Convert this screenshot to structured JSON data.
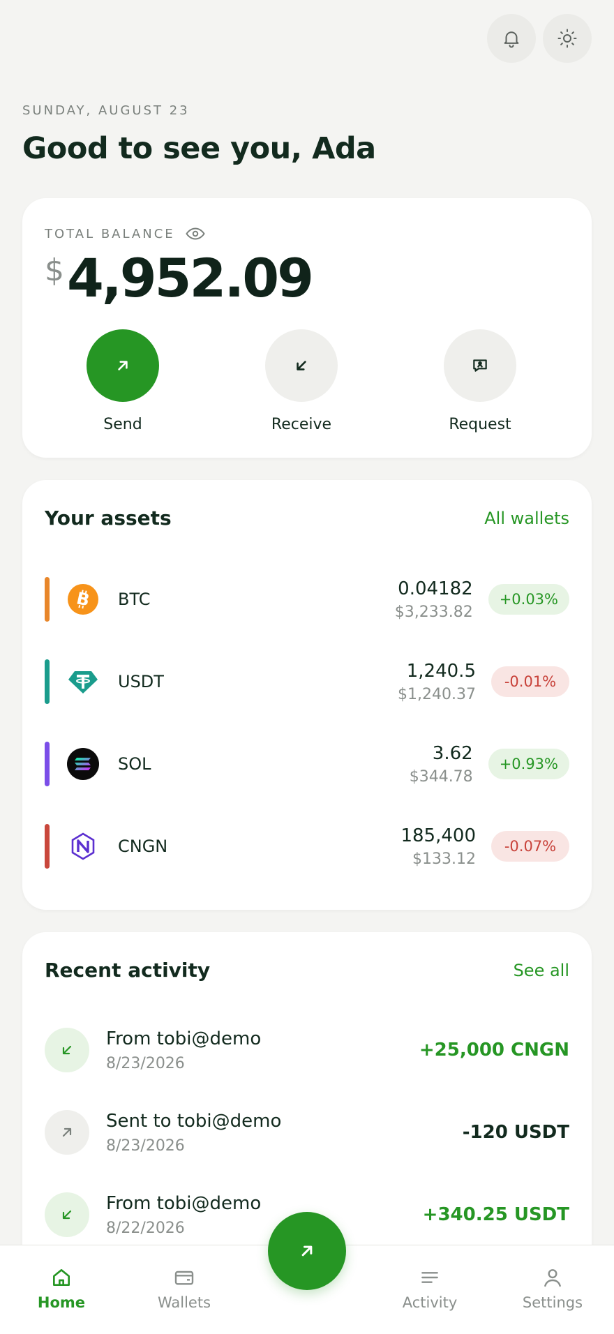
{
  "header": {
    "date": "SUNDAY, AUGUST 23",
    "greeting": "Good to see you, Ada"
  },
  "balance": {
    "label": "TOTAL BALANCE",
    "currency": "$",
    "amount": "4,952.09",
    "actions": [
      {
        "label": "Send",
        "icon": "arrow-up-right-icon"
      },
      {
        "label": "Receive",
        "icon": "arrow-down-left-icon"
      },
      {
        "label": "Request",
        "icon": "request-chat-icon"
      }
    ]
  },
  "assets": {
    "title": "Your assets",
    "link": "All wallets",
    "items": [
      {
        "symbol": "BTC",
        "qty": "0.04182",
        "usd": "$3,233.82",
        "change": "+0.03%",
        "direction": "up",
        "color": "#e8862a"
      },
      {
        "symbol": "USDT",
        "qty": "1,240.5",
        "usd": "$1,240.37",
        "change": "-0.01%",
        "direction": "down",
        "color": "#1a9c8c"
      },
      {
        "symbol": "SOL",
        "qty": "3.62",
        "usd": "$344.78",
        "change": "+0.93%",
        "direction": "up",
        "color": "#7b4ee8"
      },
      {
        "symbol": "CNGN",
        "qty": "185,400",
        "usd": "$133.12",
        "change": "-0.07%",
        "direction": "down",
        "color": "#c9473c"
      }
    ]
  },
  "activity": {
    "title": "Recent activity",
    "link": "See all",
    "items": [
      {
        "title": "From tobi@demo",
        "date": "8/23/2026",
        "amount": "+25,000 CNGN",
        "direction": "in"
      },
      {
        "title": "Sent to tobi@demo",
        "date": "8/23/2026",
        "amount": "-120 USDT",
        "direction": "out"
      },
      {
        "title": "From tobi@demo",
        "date": "8/22/2026",
        "amount": "+340.25 USDT",
        "direction": "in"
      }
    ]
  },
  "nav": {
    "items": [
      {
        "label": "Home",
        "icon": "home-icon",
        "active": true
      },
      {
        "label": "Wallets",
        "icon": "wallet-icon",
        "active": false
      },
      {
        "label": "Activity",
        "icon": "activity-list-icon",
        "active": false
      },
      {
        "label": "Settings",
        "icon": "user-icon",
        "active": false
      }
    ]
  },
  "colors": {
    "accent": "#269624",
    "up": "#269624",
    "down": "#c8423a",
    "background": "#f4f4f2"
  }
}
